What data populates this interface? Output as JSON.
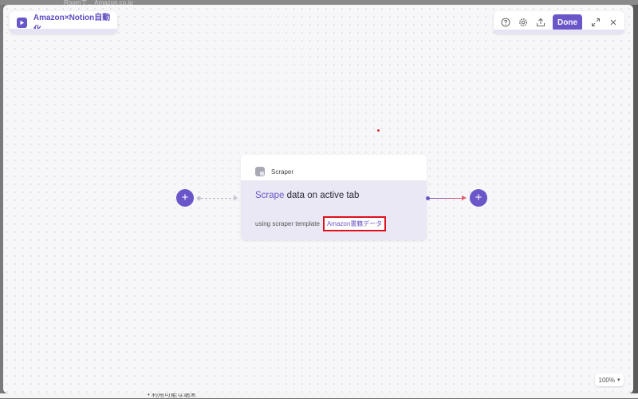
{
  "background": {
    "top_text": "Roomで... Amazon.co.jp",
    "bottom_text": "• 利用可能な端末"
  },
  "workflow": {
    "title": "Amazon×Notion自動化"
  },
  "toolbar": {
    "done_label": "Done"
  },
  "node": {
    "type_label": "Scraper",
    "title_keyword": "Scrape",
    "title_rest": " data on active tab",
    "subtitle_prefix": "using scraper template",
    "template_name": "Amazon書籍データ"
  },
  "zoom": {
    "level": "100%"
  },
  "icons": {
    "play": "play-icon",
    "help": "help-icon",
    "settings": "gear-icon",
    "share": "upload-icon",
    "expand": "expand-icon",
    "close": "close-icon"
  },
  "colors": {
    "accent": "#6b56c9",
    "highlight": "#e0101c"
  }
}
